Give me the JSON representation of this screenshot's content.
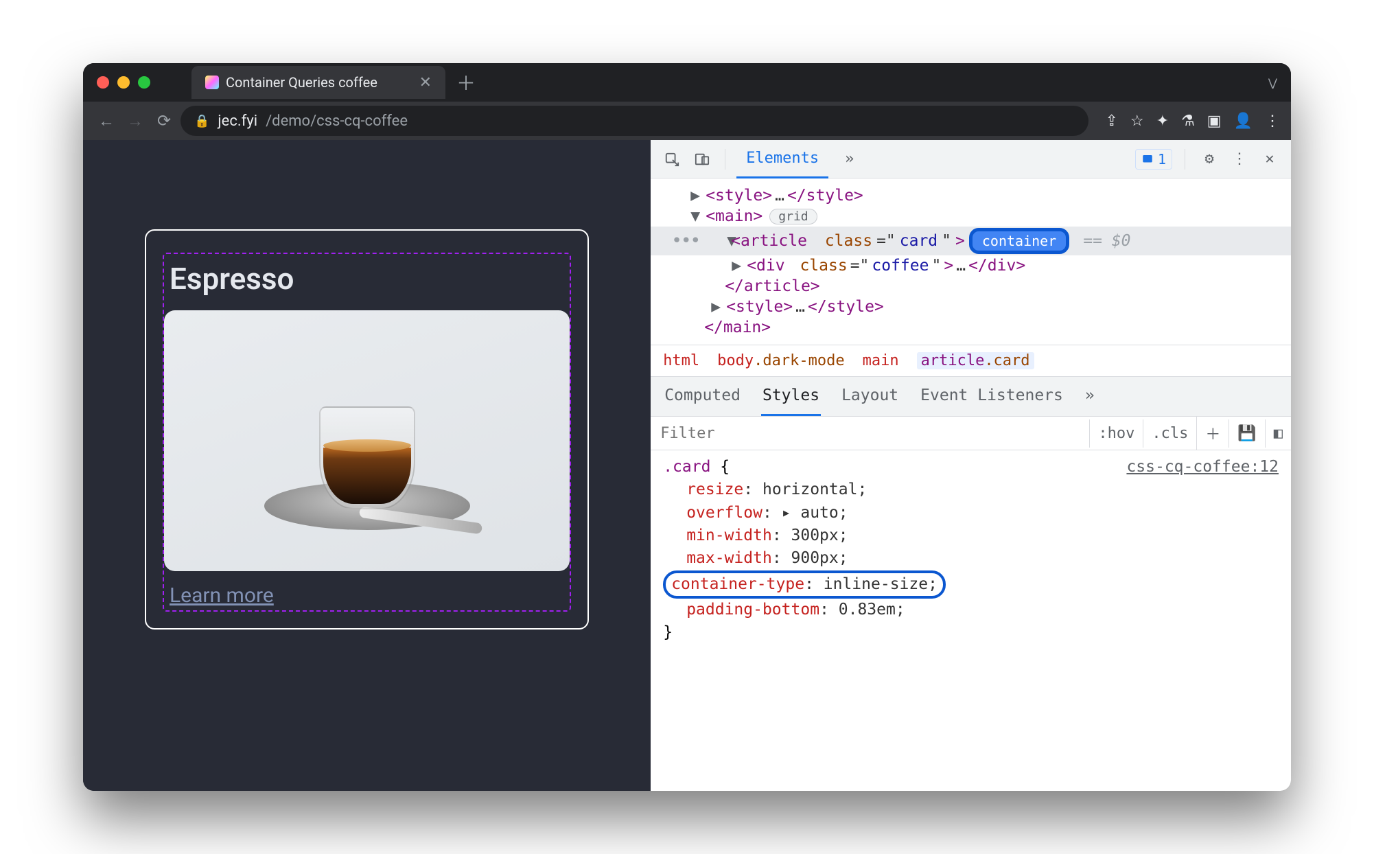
{
  "window": {
    "tab_title": "Container Queries coffee",
    "url_host": "jec.fyi",
    "url_path": "/demo/css-cq-coffee"
  },
  "page": {
    "card_title": "Espresso",
    "card_link": "Learn more"
  },
  "devtools": {
    "panel": "Elements",
    "more_panels": "»",
    "issues_count": "1",
    "dom": {
      "style_open": "<style>",
      "style_ellipsis": "…",
      "style_close": "</style>",
      "main_open": "<main>",
      "main_close": "</main>",
      "grid_badge": "grid",
      "article_open_tag": "article",
      "article_class_attr": "class",
      "article_class_val": "card",
      "container_badge": "container",
      "eq0": "== $0",
      "div_open_tag": "div",
      "div_class_attr": "class",
      "div_class_val": "coffee",
      "div_ellipsis": "…",
      "div_close": "</div>",
      "article_close": "</article>"
    },
    "crumbs": {
      "c0": "html",
      "c1": "body",
      "c1_cls": ".dark-mode",
      "c2": "main",
      "c3": "article",
      "c3_cls": ".card"
    },
    "subtabs": {
      "computed": "Computed",
      "styles": "Styles",
      "layout": "Layout",
      "event": "Event Listeners",
      "more": "»"
    },
    "filter": {
      "placeholder": "Filter",
      "hov": ":hov",
      "cls": ".cls",
      "plus": "＋"
    },
    "rule": {
      "selector": ".card",
      "open": "{",
      "close": "}",
      "source": "css-cq-coffee:12",
      "p1_name": "resize",
      "p1_val": "horizontal;",
      "p2_name": "overflow",
      "p2_val": "auto;",
      "p3_name": "min-width",
      "p3_val": "300px;",
      "p4_name": "max-width",
      "p4_val": "900px;",
      "p5_name": "container-type",
      "p5_val": "inline-size;",
      "p6_name": "padding-bottom",
      "p6_val": "0.83em;"
    }
  }
}
